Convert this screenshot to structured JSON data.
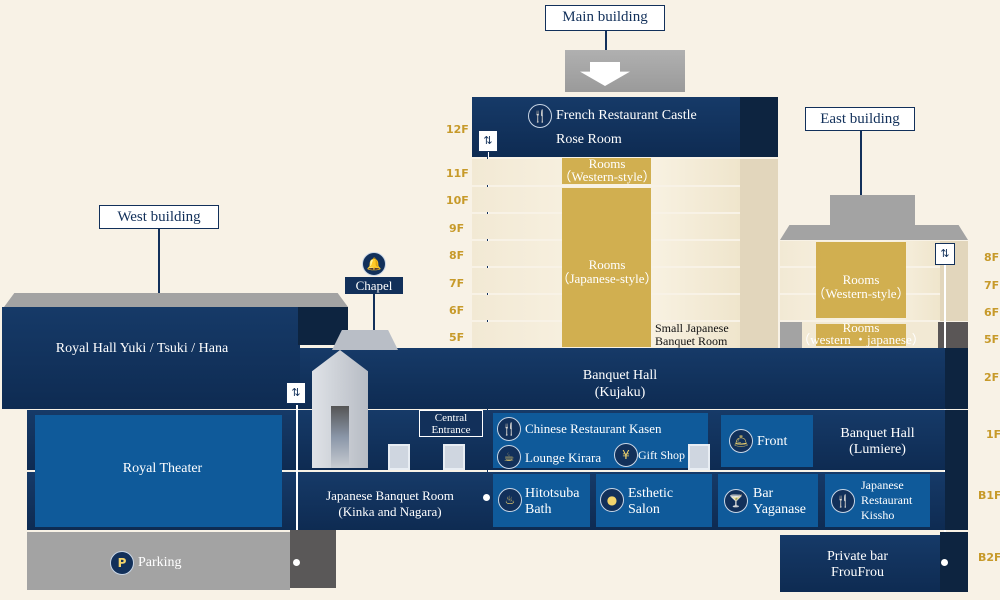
{
  "buildings": {
    "main": "Main building",
    "east": "East building",
    "west": "West building"
  },
  "floors": {
    "main": [
      "12F",
      "11F",
      "10F",
      "9F",
      "8F",
      "7F",
      "6F",
      "5F"
    ],
    "right": [
      "8F",
      "7F",
      "6F",
      "5F",
      "2F",
      "1F",
      "B1F",
      "B2F"
    ]
  },
  "rooms": {
    "french": "French Restaurant Castle",
    "rose": "Rose Room",
    "rooms_w1": "Rooms",
    "rooms_w2": "（Western-style）",
    "rooms_j1": "Rooms",
    "rooms_j2": "（Japanese-style）",
    "small_jp1": "Small Japanese",
    "small_jp2": "Banquet Room",
    "east_w1": "Rooms",
    "east_w2": "（Western-style）",
    "east_m1": "Rooms",
    "east_m2": "（western ・japanese）",
    "royal_hall": "Royal Hall  Yuki / Tsuki / Hana",
    "chapel": "Chapel",
    "kujaku1": "Banquet Hall",
    "kujaku2": "(Kujaku)",
    "royal_theater": "Royal Theater",
    "central1": "Central",
    "central2": "Entrance",
    "chinese": "Chinese Restaurant Kasen",
    "lounge": "Lounge Kirara",
    "gift": "Gift Shop",
    "front": "Front",
    "lumiere1": "Banquet Hall",
    "lumiere2": "(Lumiere)",
    "jbr1": "Japanese Banquet Room",
    "jbr2": "(Kinka and Nagara)",
    "bath1": "Hitotsuba",
    "bath2": "Bath",
    "salon1": "Esthetic",
    "salon2": "Salon",
    "bar1": "Bar",
    "bar2": "Yaganase",
    "kissho1": "Japanese",
    "kissho2": "Restaurant",
    "kissho3": "Kissho",
    "parking": "Parking",
    "froufrou1": "Private bar",
    "froufrou2": "FrouFrou"
  },
  "icons": {
    "parking": "P",
    "gift": "¥"
  },
  "colors": {
    "navy": "#12305a",
    "cell": "#0f5a9a",
    "gold": "#cfab48",
    "background": "#f8f2e6",
    "floor_label": "#c79a2a"
  }
}
